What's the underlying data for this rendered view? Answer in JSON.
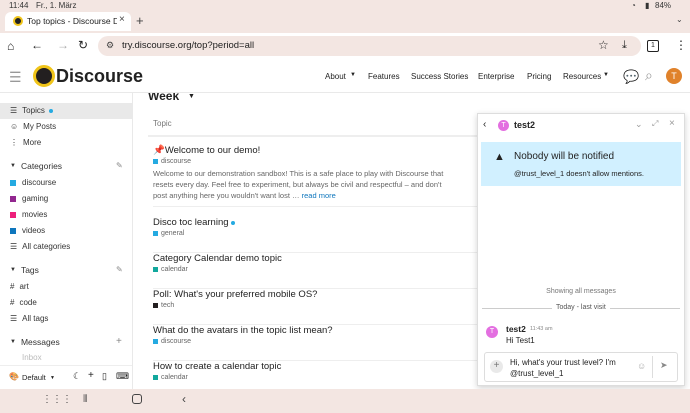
{
  "status": {
    "time": "11:44",
    "date": "Fr., 1. März",
    "battery": "84%"
  },
  "browser": {
    "tab_title": "Top topics - Discourse De",
    "url": "try.discourse.org/top?period=all",
    "tab_count": "1"
  },
  "site": {
    "logo": "Discourse",
    "nav": [
      "About",
      "Features",
      "Success Stories",
      "Enterprise",
      "Pricing",
      "Resources"
    ],
    "avatar_letter": "T",
    "accent": "#e45735"
  },
  "sidebar": {
    "items": [
      "Topics",
      "My Posts",
      "More"
    ],
    "categories_header": "Categories",
    "categories": [
      {
        "name": "discourse",
        "color": "#25aae1"
      },
      {
        "name": "gaming",
        "color": "#92278f"
      },
      {
        "name": "movies",
        "color": "#ed207b"
      },
      {
        "name": "videos",
        "color": "#0e76bd"
      }
    ],
    "all_categories": "All categories",
    "tags_header": "Tags",
    "tags": [
      "art",
      "code"
    ],
    "all_tags": "All tags",
    "messages_header": "Messages",
    "inbox": "Inbox",
    "footer_theme": "Default"
  },
  "main": {
    "period": "Week",
    "column_header": "Topic",
    "topics": [
      {
        "title": "Welcome to our demo!",
        "category": "discourse",
        "cat_color": "#25aae1",
        "excerpt": "Welcome to our demonstration sandbox! This is a safe place to play with Discourse that resets every day. Feel free to experiment, but always be civil and respectful – and don't post anything here you wouldn't want lost …",
        "read_more": "read more"
      },
      {
        "title": "Disco toc learning",
        "category": "general",
        "cat_color": "#25aae1"
      },
      {
        "title": "Category Calendar demo topic",
        "category": "calendar",
        "cat_color": "#12a89d"
      },
      {
        "title": "Poll: What's your preferred mobile OS?",
        "category": "tech",
        "cat_color": "#231f20"
      },
      {
        "title": "What do the avatars in the topic list mean?",
        "category": "discourse",
        "cat_color": "#25aae1"
      },
      {
        "title": "How to create a calendar topic",
        "category": "calendar",
        "cat_color": "#12a89d"
      }
    ]
  },
  "chat": {
    "title": "test2",
    "avatar_letter": "T",
    "notice_title": "Nobody will be notified",
    "notice_body": "@trust_level_1 doesn't allow mentions.",
    "showing_all": "Showing all messages",
    "divider": "Today - last visit",
    "message": {
      "user": "test2",
      "time": "11:43 am",
      "text": "Hi Test1"
    },
    "composer_text": "Hi, what's your trust level? I'm @trust_level_1"
  }
}
